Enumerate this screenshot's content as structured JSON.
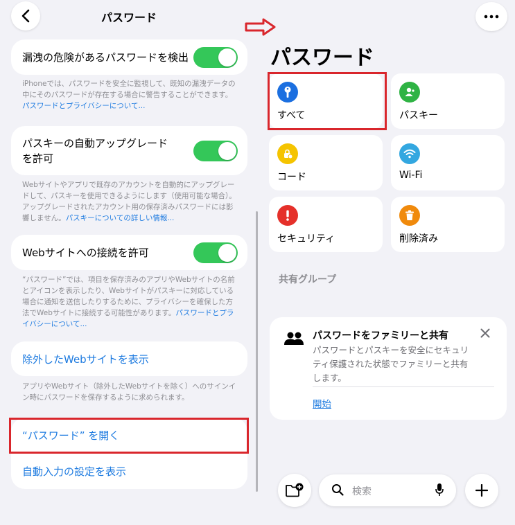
{
  "left": {
    "title": "パスワード",
    "leak_toggle": {
      "label": "漏洩の危険があるパスワードを検出",
      "on": true
    },
    "leak_note": "iPhoneでは、パスワードを安全に監視して、既知の漏洩データの中にそのパスワードが存在する場合に警告することができます。",
    "leak_link": "パスワードとプライバシーについて...",
    "passkey_toggle": {
      "label_line1": "パスキーの自動アップグレード",
      "label_line2": "を許可",
      "on": true
    },
    "passkey_note": "Webサイトやアプリで既存のアカウントを自動的にアップグレードして、パスキーを使用できるようにします（使用可能な場合）。アップグレードされたアカウント用の保存済みパスワードには影響しません。",
    "passkey_link": "パスキーについての詳しい情報...",
    "web_toggle": {
      "label": "Webサイトへの接続を許可",
      "on": true
    },
    "web_note": "“パスワード”では、項目を保存済みのアプリやWebサイトの名前とアイコンを表示したり、Webサイトがパスキーに対応している場合に通知を送信したりするために、プライバシーを確保した方法でWebサイトに接続する可能性があります。",
    "web_link": "パスワードとプライバシーについて...",
    "excluded_sites": "除外したWebサイトを表示",
    "excluded_note": "アプリやWebサイト（除外したWebサイトを除く）へのサインイン時にパスワードを保存するように求められます。",
    "open_passwords": "“パスワード” を開く",
    "autofill_settings": "自動入力の設定を表示"
  },
  "right": {
    "title": "パスワード",
    "tiles": [
      {
        "label": "すべて",
        "icon": "key-icon",
        "color": "#1b6fe0"
      },
      {
        "label": "パスキー",
        "icon": "person-badge-icon",
        "color": "#2fb344"
      },
      {
        "label": "コード",
        "icon": "lock-clock-icon",
        "color": "#f5c400"
      },
      {
        "label": "Wi-Fi",
        "icon": "wifi-icon",
        "color": "#33a7e0"
      },
      {
        "label": "セキュリティ",
        "icon": "exclamation-icon",
        "color": "#e5302a"
      },
      {
        "label": "削除済み",
        "icon": "trash-icon",
        "color": "#f08a0c"
      }
    ],
    "shared_groups": "共有グループ",
    "family": {
      "title": "パスワードをファミリーと共有",
      "description": "パスワードとパスキーを安全にセキュリティ保護された状態でファミリーと共有します。",
      "start": "開始"
    },
    "search_placeholder": "検索"
  },
  "colors": {
    "accent": "#1e7be0",
    "highlight_box": "#d9262c",
    "toggle_on": "#34c759",
    "arrow": "#d9262c"
  }
}
